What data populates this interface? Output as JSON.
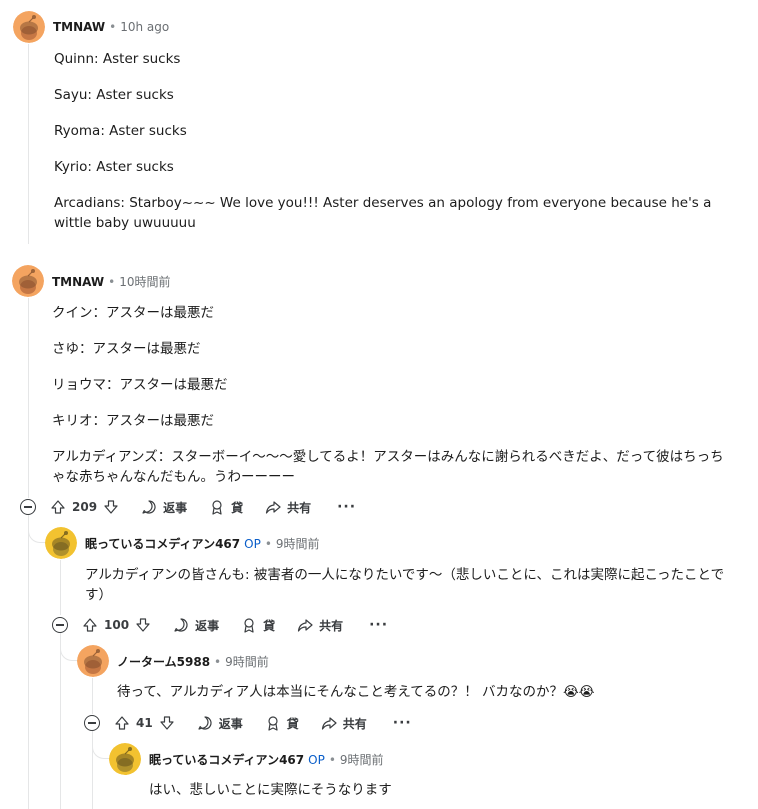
{
  "comments": [
    {
      "author": "TMNAW",
      "time": "10h ago",
      "op": false,
      "paragraphs": [
        "Quinn: Aster sucks",
        "Sayu: Aster sucks",
        "Ryoma: Aster sucks",
        "Kyrio: Aster sucks",
        "Arcadians: Starboy~~~ We love you!!! Aster deserves an apology from everyone because he's a wittle baby uwuuuuu"
      ]
    },
    {
      "author": "TMNAW",
      "time": "10時間前",
      "op": false,
      "paragraphs": [
        "クイン：アスターは最悪だ",
        "さゆ：アスターは最悪だ",
        "リョウマ：アスターは最悪だ",
        "キリオ：アスターは最悪だ",
        "アルカディアンズ：スターボーイ〜〜〜愛してるよ！アスターはみんなに謝られるべきだよ、だって彼はちっちゃな赤ちゃんなんだもん。うわーーーー"
      ],
      "actions": {
        "votes": "209",
        "reply": "返事",
        "award": "貸",
        "share": "共有",
        "more": "···"
      }
    },
    {
      "author": "眠っているコメディアン467",
      "op": true,
      "op_label": "OP",
      "time": "9時間前",
      "paragraphs": [
        "アルカディアンの皆さんも: 被害者の一人になりたいです～（悲しいことに、これは実際に起こったことです）"
      ],
      "actions": {
        "votes": "100",
        "reply": "返事",
        "award": "貸",
        "share": "共有",
        "more": "···"
      }
    },
    {
      "author": "ノーターム5988",
      "op": false,
      "time": "9時間前",
      "paragraphs": [
        "待って、アルカディア人は本当にそんなこと考えてるの？！ バカなのか？😭😭"
      ],
      "actions": {
        "votes": "41",
        "reply": "返事",
        "award": "貸",
        "share": "共有",
        "more": "···"
      }
    },
    {
      "author": "眠っているコメディアン467",
      "op": true,
      "op_label": "OP",
      "time": "9時間前",
      "paragraphs": [
        "はい、悲しいことに実際にそうなります"
      ]
    }
  ],
  "separator": "•",
  "colors": {
    "avatar_orange": "#f4a460",
    "avatar_yellow": "#f2c230",
    "op_blue": "#0a5ec9",
    "thread_line": "#e5e6e7"
  }
}
